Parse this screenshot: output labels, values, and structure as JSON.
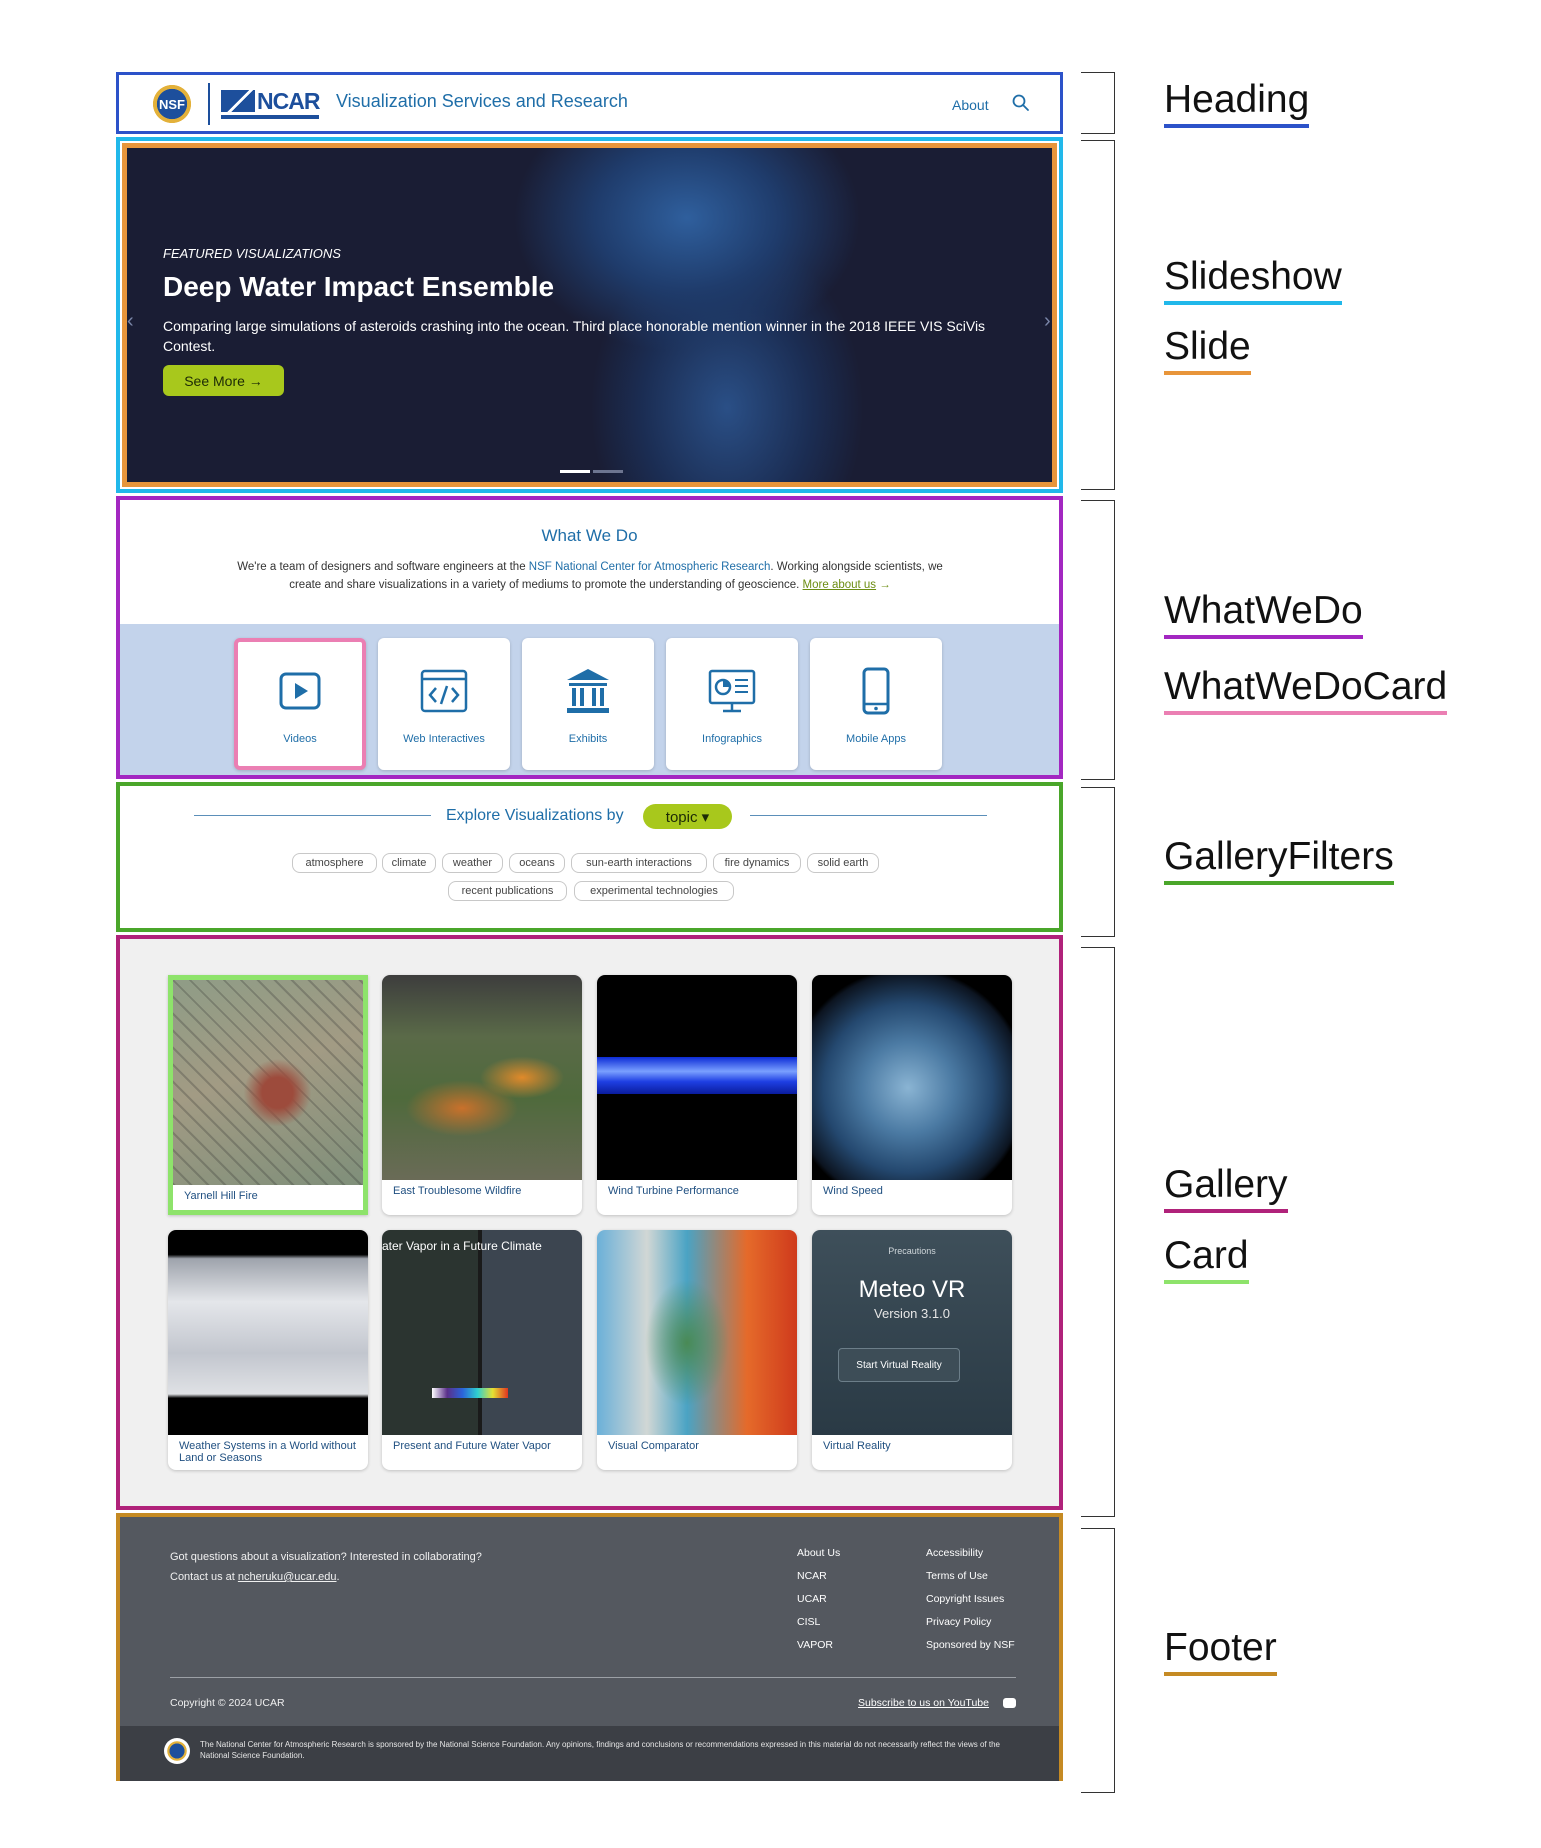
{
  "header": {
    "nsf_logo_text": "NSF",
    "ncar_logo_text": "NCAR",
    "site_title": "Visualization Services and Research",
    "nav_about": "About",
    "search_icon": "search-icon"
  },
  "slide": {
    "eyebrow": "FEATURED VISUALIZATIONS",
    "title": "Deep Water Impact Ensemble",
    "description": "Comparing large simulations of asteroids crashing into the ocean. Third place honorable mention winner in the 2018 IEEE VIS SciVis Contest.",
    "button_label": "See More →",
    "prev_arrow": "‹",
    "next_arrow": "›"
  },
  "whatwedo": {
    "title": "What We Do",
    "text_1": "We're a team of designers and software engineers at the ",
    "link_ncar": "NSF National Center for Atmospheric Research",
    "text_2": ". Working alongside scientists, we create and share visualizations in a variety of mediums to promote the understanding of geoscience. ",
    "link_more": "More about us",
    "arrow": " →",
    "cards": [
      {
        "label": "Videos",
        "icon": "play-icon"
      },
      {
        "label": "Web Interactives",
        "icon": "code-window-icon"
      },
      {
        "label": "Exhibits",
        "icon": "museum-icon"
      },
      {
        "label": "Infographics",
        "icon": "chart-monitor-icon"
      },
      {
        "label": "Mobile Apps",
        "icon": "smartphone-icon"
      }
    ]
  },
  "filters": {
    "label": "Explore Visualizations by",
    "selected": "topic ▾",
    "chips": [
      "atmosphere",
      "climate",
      "weather",
      "oceans",
      "sun-earth interactions",
      "fire dynamics",
      "solid earth",
      "recent publications",
      "experimental technologies"
    ]
  },
  "gallery": {
    "cards": [
      {
        "caption": "Yarnell Hill Fire"
      },
      {
        "caption": "East Troublesome Wildfire"
      },
      {
        "caption": "Wind Turbine Performance"
      },
      {
        "caption": "Wind Speed"
      },
      {
        "caption": "Weather Systems in a World without Land or Seasons"
      },
      {
        "caption": "Present and Future Water Vapor",
        "thumb_title": "ater Vapor in a Future Climate"
      },
      {
        "caption": "Visual Comparator"
      },
      {
        "caption": "Virtual Reality",
        "vr_precautions": "Precautions",
        "vr_title": "Meteo VR",
        "vr_version": "Version 3.1.0",
        "vr_button": "Start Virtual Reality"
      }
    ]
  },
  "footer": {
    "question": "Got questions about a visualization? Interested in collaborating?",
    "contact_prefix": "Contact us at ",
    "contact_email": "ncheruku@ucar.edu",
    "contact_suffix": ".",
    "links_col1": [
      "About Us",
      "NCAR",
      "UCAR",
      "CISL",
      "VAPOR"
    ],
    "links_col2": [
      "Accessibility",
      "Terms of Use",
      "Copyright Issues",
      "Privacy Policy",
      "Sponsored by NSF"
    ],
    "copyright": "Copyright © 2024 UCAR",
    "youtube": "Subscribe to us on YouTube",
    "disclaimer": "The National Center for Atmospheric Research is sponsored by the National Science Foundation. Any opinions, findings and conclusions or recommendations expressed in this material do not necessarily reflect the views of the National Science Foundation."
  },
  "annotations": {
    "heading": "Heading",
    "slideshow": "Slideshow",
    "slide": "Slide",
    "whatwedo": "WhatWeDo",
    "whatwedocard": "WhatWeDoCard",
    "galleryfilters": "GalleryFilters",
    "gallery": "Gallery",
    "card": "Card",
    "footer": "Footer"
  },
  "colors": {
    "heading": "#2c52c9",
    "slideshow": "#21b8ea",
    "slide": "#e8953a",
    "whatwedo": "#a327c1",
    "whatwedocard": "#eb7fb3",
    "galleryfilters": "#4aa62a",
    "gallery": "#b0227a",
    "card": "#8ee36b",
    "footer": "#c58a23",
    "accent_green": "#a8c81c",
    "brand_blue": "#1f6ea8"
  }
}
